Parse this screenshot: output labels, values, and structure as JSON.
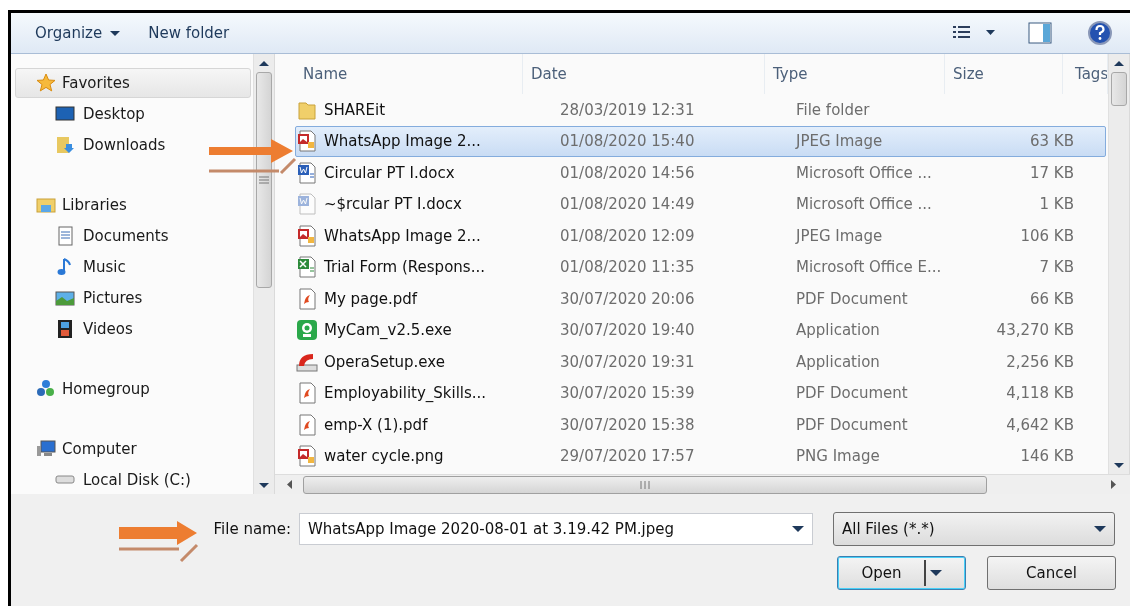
{
  "toolbar": {
    "organize": "Organize",
    "new_folder": "New folder"
  },
  "sidebar": {
    "groups": [
      {
        "label": "Favorites",
        "kind": "star",
        "selected": true,
        "children": [
          {
            "label": "Desktop",
            "kind": "desktop"
          },
          {
            "label": "Downloads",
            "kind": "downloads"
          }
        ]
      },
      {
        "label": "Libraries",
        "kind": "library",
        "selected": false,
        "children": [
          {
            "label": "Documents",
            "kind": "documents"
          },
          {
            "label": "Music",
            "kind": "music"
          },
          {
            "label": "Pictures",
            "kind": "pictures"
          },
          {
            "label": "Videos",
            "kind": "videos"
          }
        ]
      },
      {
        "label": "Homegroup",
        "kind": "homegroup",
        "selected": false
      },
      {
        "label": "Computer",
        "kind": "computer",
        "selected": false,
        "children": [
          {
            "label": "Local Disk (C:)",
            "kind": "disk"
          }
        ]
      }
    ]
  },
  "table": {
    "columns": [
      "Name",
      "Date",
      "Type",
      "Size",
      "Tags"
    ],
    "rows": [
      {
        "name": "SHAREit",
        "date": "28/03/2019 12:31",
        "type": "File folder",
        "size": "",
        "kind": "folder",
        "selected": false
      },
      {
        "name": "WhatsApp Image 2...",
        "date": "01/08/2020 15:40",
        "type": "JPEG Image",
        "size": "63 KB",
        "kind": "image",
        "selected": true
      },
      {
        "name": "Circular PT I.docx",
        "date": "01/08/2020 14:56",
        "type": "Microsoft Office ...",
        "size": "17 KB",
        "kind": "word",
        "selected": false
      },
      {
        "name": "~$rcular PT I.docx",
        "date": "01/08/2020 14:49",
        "type": "Microsoft Office ...",
        "size": "1 KB",
        "kind": "word-temp",
        "selected": false
      },
      {
        "name": "WhatsApp Image 2...",
        "date": "01/08/2020 12:09",
        "type": "JPEG Image",
        "size": "106 KB",
        "kind": "image",
        "selected": false
      },
      {
        "name": "Trial Form (Respons...",
        "date": "01/08/2020 11:35",
        "type": "Microsoft Office E...",
        "size": "7 KB",
        "kind": "excel",
        "selected": false
      },
      {
        "name": "My page.pdf",
        "date": "30/07/2020 20:06",
        "type": "PDF Document",
        "size": "66 KB",
        "kind": "pdf",
        "selected": false
      },
      {
        "name": "MyCam_v2.5.exe",
        "date": "30/07/2020 19:40",
        "type": "Application",
        "size": "43,270 KB",
        "kind": "camera-app",
        "selected": false
      },
      {
        "name": "OperaSetup.exe",
        "date": "30/07/2020 19:31",
        "type": "Application",
        "size": "2,256 KB",
        "kind": "setup-app",
        "selected": false
      },
      {
        "name": "Employability_Skills...",
        "date": "30/07/2020 15:39",
        "type": "PDF Document",
        "size": "4,118 KB",
        "kind": "pdf",
        "selected": false
      },
      {
        "name": "emp-X (1).pdf",
        "date": "30/07/2020 15:38",
        "type": "PDF Document",
        "size": "4,642 KB",
        "kind": "pdf",
        "selected": false
      },
      {
        "name": "water cycle.png",
        "date": "29/07/2020 17:57",
        "type": "PNG Image",
        "size": "146 KB",
        "kind": "image",
        "selected": false
      }
    ]
  },
  "file_name": {
    "label": "File name:",
    "value": "WhatsApp Image 2020-08-01 at 3.19.42 PM.jpeg"
  },
  "filter": "All Files (*.*)",
  "buttons": {
    "open": "Open",
    "cancel": "Cancel"
  }
}
